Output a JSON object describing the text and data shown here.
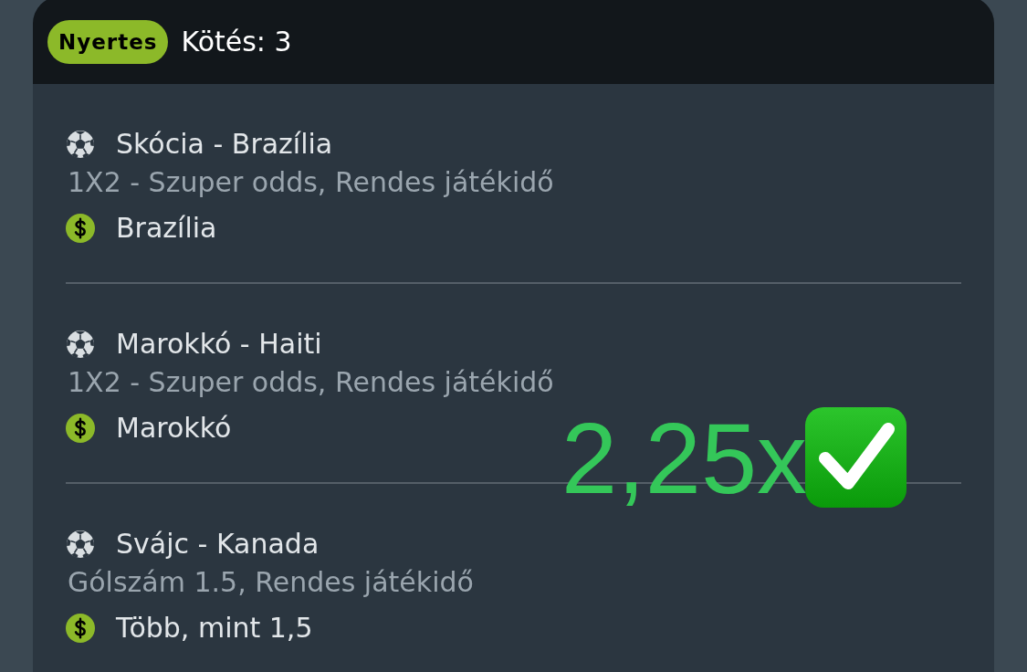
{
  "header": {
    "status_badge": "Nyertes",
    "title": "Kötés: 3"
  },
  "bets": [
    {
      "match": "Skócia - Brazília",
      "market": "1X2 - Szuper odds, Rendes játékidő",
      "selection": "Brazília"
    },
    {
      "match": "Marokkó - Haiti",
      "market": "1X2 - Szuper odds, Rendes játékidő",
      "selection": "Marokkó"
    },
    {
      "match": "Svájc - Kanada",
      "market": "Gólszám 1.5, Rendes játékidő",
      "selection": "Több, mint 1,5"
    }
  ],
  "overlay": {
    "text": "2,25x"
  }
}
